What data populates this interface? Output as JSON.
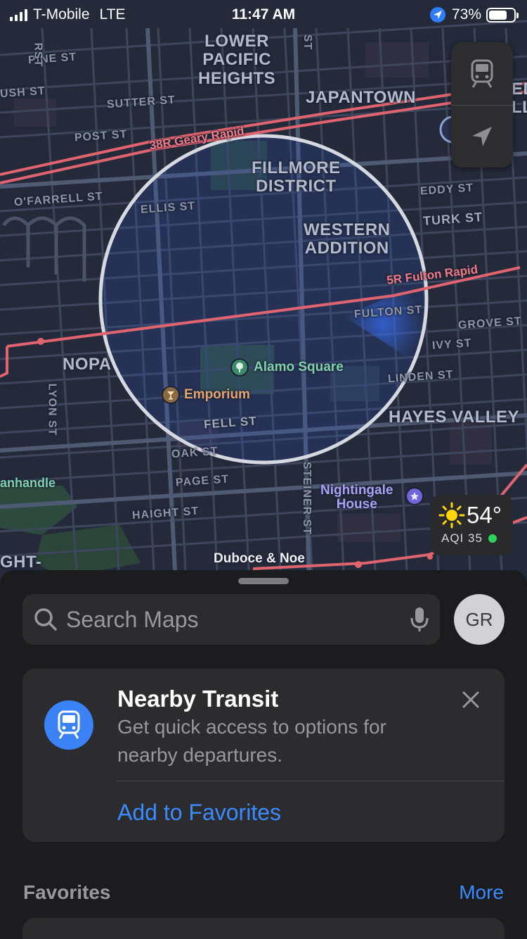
{
  "status_bar": {
    "carrier": "T-Mobile",
    "network": "LTE",
    "time": "11:47 AM",
    "battery": "73%",
    "battery_level": 0.73
  },
  "map": {
    "neighborhoods": {
      "lower_pacific_heights": "LOWER\nPACIFIC\nHEIGHTS",
      "japantown": "JAPANTOWN",
      "fillmore": "FILLMORE\nDISTRICT",
      "western_addition": "WESTERN\nADDITION",
      "nopa": "NOPA",
      "hayes_valley": "HAYES VALLEY"
    },
    "streets": {
      "pine": "PINE ST",
      "bush": "USH ST",
      "sutter": "SUTTER ST",
      "post": "POST ST",
      "ofarrell": "O'FARRELL ST",
      "ellis": "ELLIS ST",
      "eddy": "EDDY ST",
      "turk": "TURK ST",
      "fulton": "FULTON ST",
      "grove": "GROVE ST",
      "ivy": "IVY ST",
      "linden": "LINDEN ST",
      "fell": "FELL ST",
      "oak": "OAK ST",
      "page": "PAGE ST",
      "haight": "HAIGHT ST",
      "lyon": "LYON ST",
      "steiner": "STEINER ST",
      "rst": "RST",
      "st_top": "ST"
    },
    "transit_lines": {
      "geary": "38R Geary Rapid",
      "fulton": "5R Fulton Rapid"
    },
    "pois": {
      "alamo_square": "Alamo Square",
      "emporium": "Emporium",
      "nightingale": "Nightingale\nHouse",
      "panhandle": "Panhandle",
      "duboce": "Duboce & Noe",
      "edge_ght": "GHT-",
      "edge_ed": "ED\nLL"
    },
    "icons": {
      "transit_button": "tram-icon",
      "location_button": "location-arrow-icon"
    }
  },
  "weather": {
    "temp": "54°",
    "aqi": "AQI 35",
    "aqi_color": "#30d158"
  },
  "sheet": {
    "search_placeholder": "Search Maps",
    "avatar_initials": "GR",
    "transit_card": {
      "title": "Nearby Transit",
      "description": "Get quick access to options for nearby departures.",
      "action": "Add to Favorites"
    },
    "favorites": {
      "heading": "Favorites",
      "more": "More"
    }
  },
  "colors": {
    "accent": "#3a8bff",
    "transit_icon_bg": "#3a82f6",
    "route_red": "#e0646f"
  }
}
